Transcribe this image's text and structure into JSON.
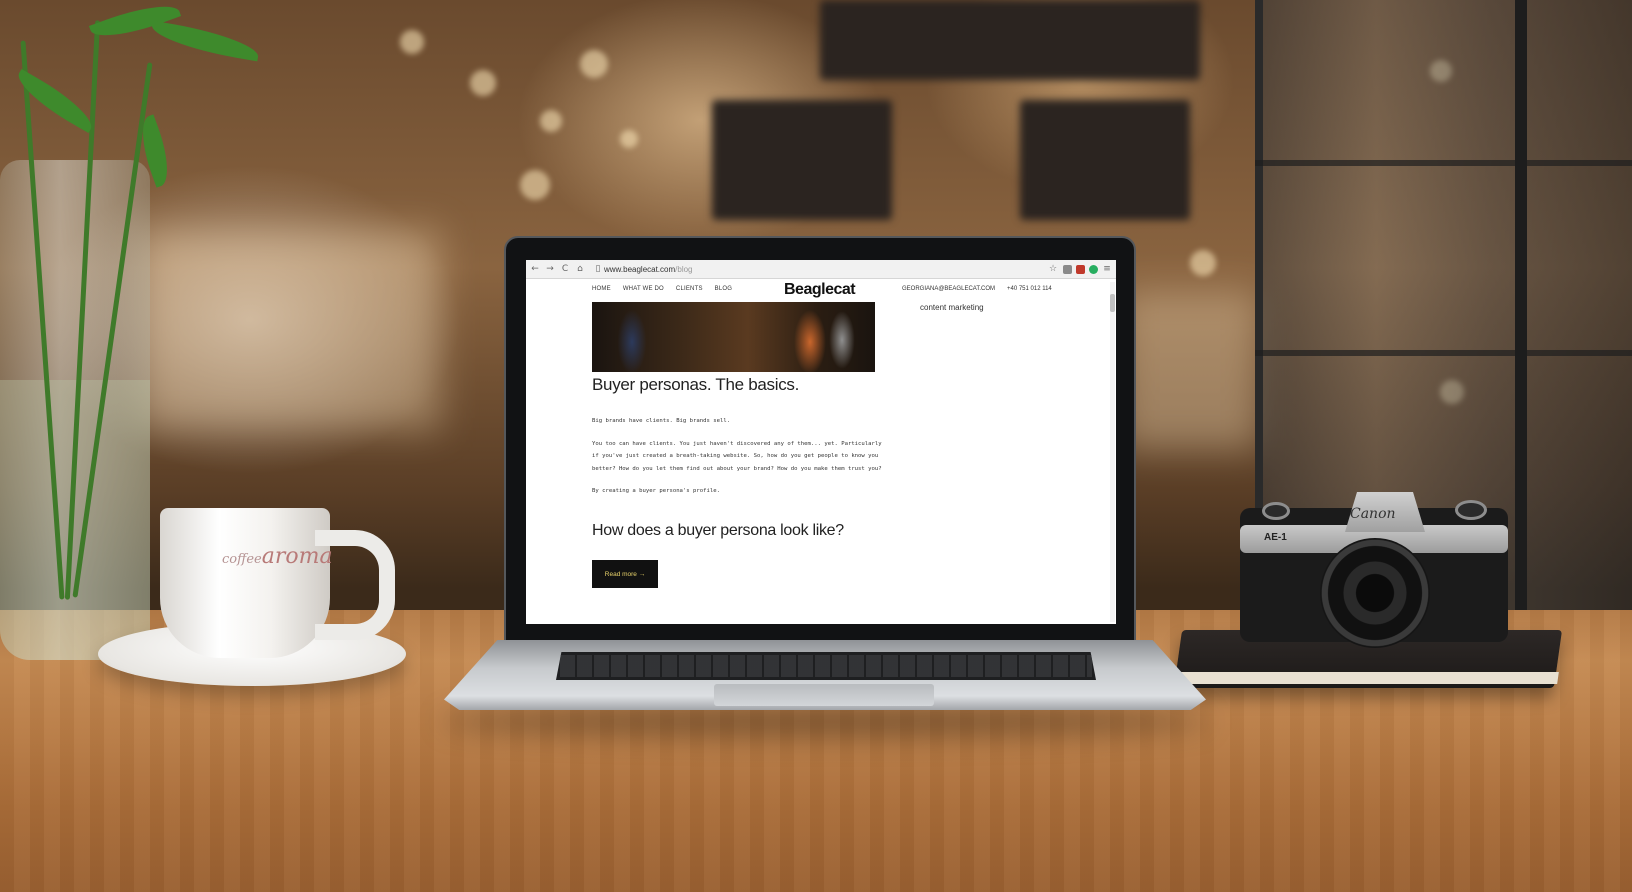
{
  "browser": {
    "url_host": "www.beaglecat.com",
    "url_path": "/blog",
    "back_glyph": "←",
    "forward_glyph": "→",
    "reload_glyph": "C",
    "home_glyph": "⌂",
    "menu_glyph": "≡",
    "icons": [
      "back-arrow-icon",
      "forward-arrow-icon",
      "reload-icon",
      "home-icon",
      "bookmark-star-icon",
      "menu-icon"
    ]
  },
  "site": {
    "nav": [
      "HOME",
      "WHAT WE DO",
      "CLIENTS",
      "BLOG"
    ],
    "logo": "Beaglecat",
    "email": "GEORGIANA@BEAGLECAT.COM",
    "phone": "+40 751 012 114",
    "sidebar_tag": "content marketing"
  },
  "post": {
    "title": "Buyer personas. The basics.",
    "paragraphs": [
      "Big brands have clients. Big brands sell.",
      "You too can have clients. You just haven't discovered any of them... yet. Particularly if you've just created a breath-taking website. So, how do you get people to know you better? How do you let them find out about your brand? How do you make them trust you?",
      "By creating a buyer persona's profile."
    ],
    "subheading": "How does a buyer persona look like?",
    "read_more": "Read more →"
  },
  "scene": {
    "cup_brand_script": "coffee",
    "cup_brand": "aroma",
    "camera_brand": "Canon",
    "camera_model": "AE-1"
  },
  "colors": {
    "read_more_bg": "#111111",
    "read_more_text": "#e8d26a",
    "table_wood": "#b87b44"
  }
}
